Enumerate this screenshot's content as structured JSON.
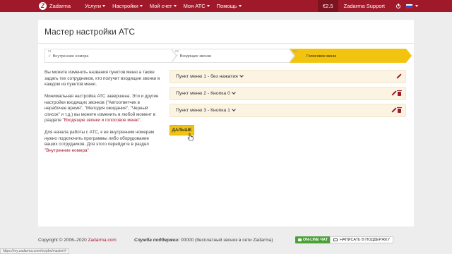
{
  "app": {
    "logo_letter": "Z",
    "brand": "Zadarma"
  },
  "nav": {
    "items": [
      {
        "label": "Услуги"
      },
      {
        "label": "Настройки"
      },
      {
        "label": "Мой счет"
      },
      {
        "label": "Моя АТС"
      },
      {
        "label": "Помощь"
      }
    ],
    "balance": "€2.5",
    "account": "Zadarma Support"
  },
  "page": {
    "title": "Мастер настройки АТС"
  },
  "wizard": {
    "steps": [
      {
        "num": "01",
        "label": "Внутренние номера",
        "done": true
      },
      {
        "num": "02",
        "label": "Входящие звонки",
        "done": true
      },
      {
        "num": "03",
        "label": "Голосовое меню",
        "active": true
      }
    ],
    "check_mark": "✓"
  },
  "description": {
    "p1": "Вы можете изменить названия пунктов меню а также задать тех сотрудников, кто получит входящие звонки в каждом из пунктов меню.",
    "p2_text": "Минимальная настройка АТС завершена. Эти и другие настройки входящих звонков (\"Автоответчик в нерабочее время\", \"Мелодия ожидания\", \"Черный список\" и т.д.) вы можете изменить в любой момент в разделе ",
    "p2_link": "\"Входящие звонки и голосовое меню\"",
    "p2_end": ".",
    "p3_text": "Для начала работы с АТС, к ее внутренним номерам нужно подключить программы либо оборудование ваших сотрудников. Для этого перейдите в раздел ",
    "p3_link": "\"Внутренние номера\""
  },
  "menu_items": [
    {
      "label": "Пункт меню 1 - без нажатия"
    },
    {
      "label": "Пункт меню 2 - Кнопка 0"
    },
    {
      "label": "Пункт меню 3 - Кнопка 1"
    }
  ],
  "next_button": "ДАЛЬШЕ",
  "footer": {
    "copyright": "Copyright © 2006–2020 ",
    "copyright_link": "Zadarma.com",
    "support_label": "Служба поддержки:",
    "support_text": " 00000 (бесплатный звонок в сети Zadarma)",
    "online_chat": "ON-LINE ЧАТ",
    "write_support": "НАПИСАТЬ В ПОДДЕРЖКУ"
  },
  "status_url": "https://my.zadarma.com/mypbx/master/#",
  "colors": {
    "brand": "#a0192a",
    "accent": "#f2c40f",
    "online": "#4aa236"
  }
}
